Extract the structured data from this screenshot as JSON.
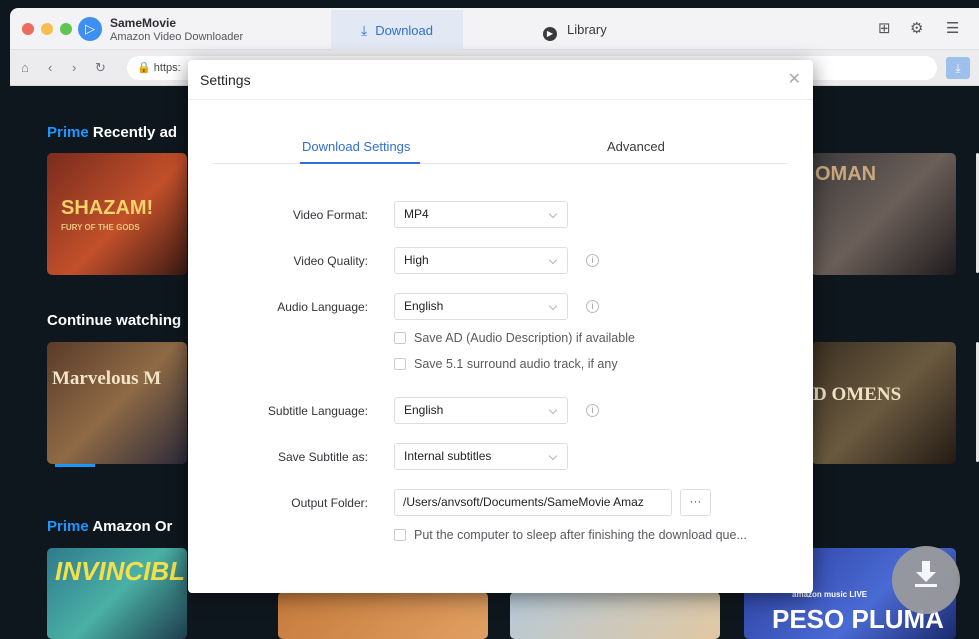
{
  "app": {
    "name": "SameMovie",
    "subtitle": "Amazon Video Downloader"
  },
  "tabs": {
    "download": "Download",
    "library": "Library"
  },
  "browser": {
    "url": "https:"
  },
  "background": {
    "section1": {
      "prime": "Prime",
      "title": "Recently ad"
    },
    "section2": {
      "title": "Continue watching"
    },
    "section3": {
      "prime": "Prime",
      "title": "Amazon Or"
    },
    "posters": {
      "shazam": "SHAZAM!",
      "shazam_sub": "FURY OF THE GODS",
      "woman": "OMAN",
      "marvelous": "Marvelous M",
      "omens": "D OMENS",
      "invincible": "INVINCIBL",
      "peso_brand": "amazon music LIVE",
      "peso": "PESO PLUMA"
    }
  },
  "settings": {
    "title": "Settings",
    "tab_download": "Download Settings",
    "tab_advanced": "Advanced",
    "video_format": {
      "label": "Video Format:",
      "value": "MP4"
    },
    "video_quality": {
      "label": "Video Quality:",
      "value": "High"
    },
    "audio_language": {
      "label": "Audio Language:",
      "value": "English"
    },
    "save_ad": "Save AD (Audio Description) if available",
    "save_51": "Save 5.1 surround audio track, if any",
    "subtitle_language": {
      "label": "Subtitle Language:",
      "value": "English"
    },
    "save_subtitle": {
      "label": "Save Subtitle as:",
      "value": "Internal subtitles"
    },
    "output_folder": {
      "label": "Output Folder:",
      "value": "/Users/anvsoft/Documents/SameMovie Amaz"
    },
    "browse_label": "···",
    "sleep": "Put the computer to sleep after finishing the download que..."
  }
}
